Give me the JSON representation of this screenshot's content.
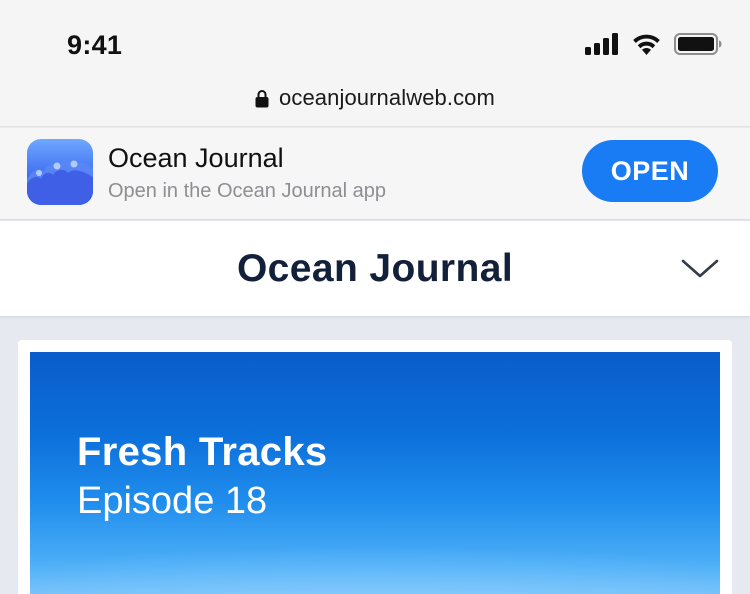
{
  "status_bar": {
    "time": "9:41",
    "icons": [
      "signal-icon",
      "wifi-icon",
      "battery-icon"
    ]
  },
  "url_bar": {
    "url": "oceanjournalweb.com",
    "icon": "lock-icon"
  },
  "app_banner": {
    "app_name": "Ocean Journal",
    "subtitle": "Open in the Ocean Journal app",
    "open_label": "OPEN",
    "icon": "app-wave-icon"
  },
  "site_header": {
    "title": "Ocean Journal",
    "menu_icon": "chevron-down-icon"
  },
  "feature": {
    "title": "Fresh Tracks",
    "subtitle": "Episode 18"
  },
  "colors": {
    "accent": "#1a7cf5",
    "title_text": "#13203a",
    "hero_blue": "#0c6fda",
    "page_bg": "#e6e9f0"
  }
}
